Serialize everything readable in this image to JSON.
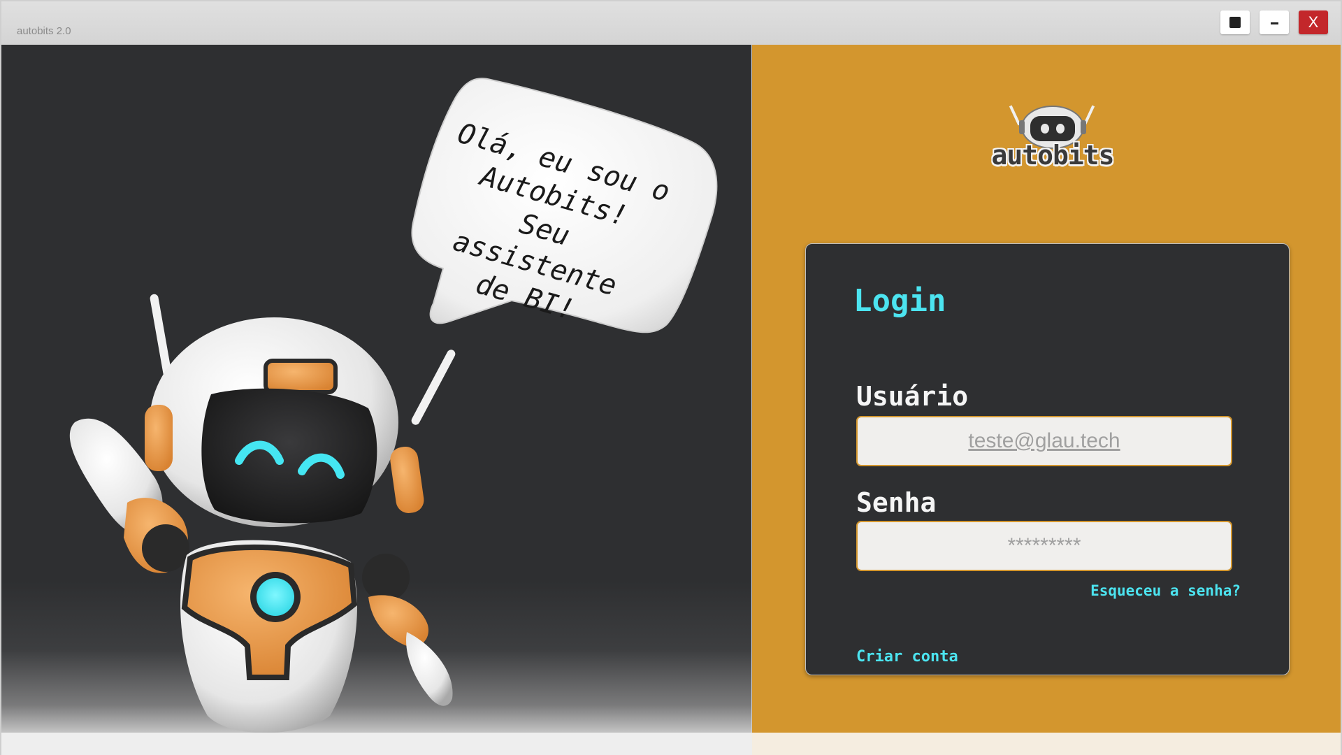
{
  "window": {
    "title": "autobits 2.0",
    "maximize_icon": "square-icon",
    "minimize_icon": "minus-icon",
    "close_label": "X"
  },
  "welcome": {
    "speech_lines": [
      "Olá, eu sou o",
      "Autobits!",
      "Seu assistente",
      "de BI!"
    ]
  },
  "brand": {
    "logo_text": "autobits"
  },
  "login": {
    "title": "Login",
    "user_label": "Usuário",
    "user_placeholder": "teste@glau.tech",
    "password_label": "Senha",
    "password_placeholder": "*********",
    "forgot_password": "Esqueceu a senha?",
    "create_account": "Criar conta"
  },
  "colors": {
    "accent": "#4ce4f0",
    "panel": "#2e2f31",
    "brand_orange": "#d3962e",
    "close_red": "#c3272b"
  }
}
